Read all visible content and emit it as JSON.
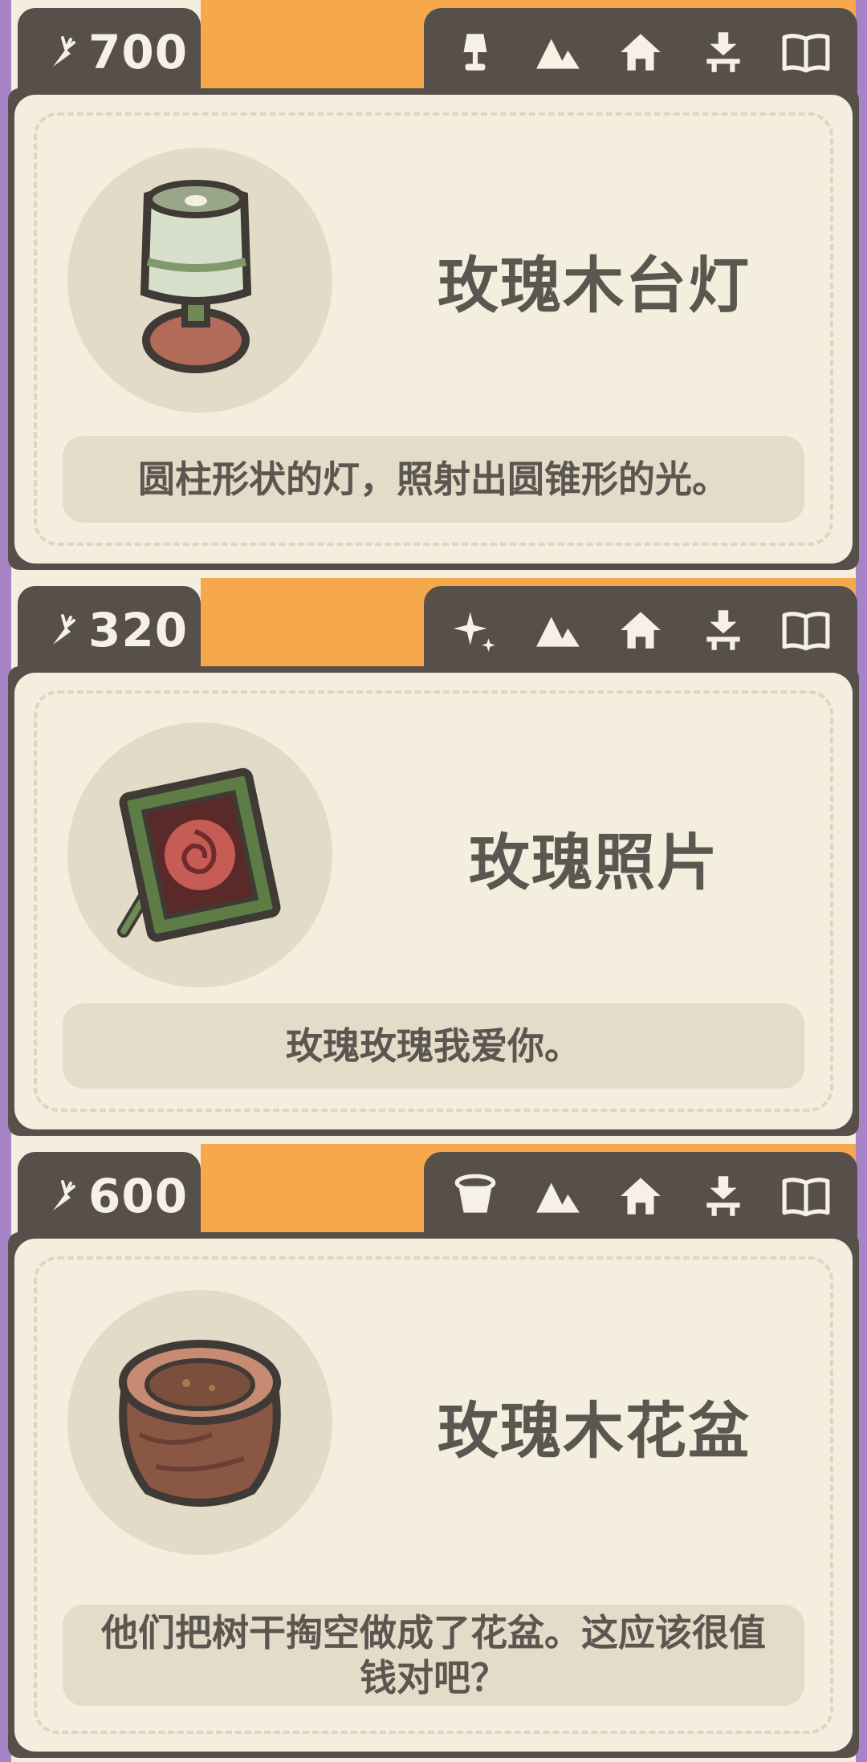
{
  "colors": {
    "dark": "#564f4a",
    "cream": "#f3eede",
    "orange": "#f6a94a",
    "text": "#5c5650"
  },
  "tab_icons": [
    "mountains-icon",
    "house-icon",
    "fountain-icon",
    "book-icon"
  ],
  "items": [
    {
      "price": "700",
      "category_icon": "lamp-icon",
      "item_icon": "rosewood-lamp-icon",
      "name": "玫瑰木台灯",
      "description": "圆柱形状的灯，照射出圆锥形的光。"
    },
    {
      "price": "320",
      "category_icon": "sparkle-icon",
      "item_icon": "rose-photo-icon",
      "name": "玫瑰照片",
      "description": "玫瑰玫瑰我爱你。"
    },
    {
      "price": "600",
      "category_icon": "flowerpot-icon",
      "item_icon": "rosewood-flowerpot-icon",
      "name": "玫瑰木花盆",
      "description": "他们把树干掏空做成了花盆。这应该很值钱对吧？"
    }
  ]
}
